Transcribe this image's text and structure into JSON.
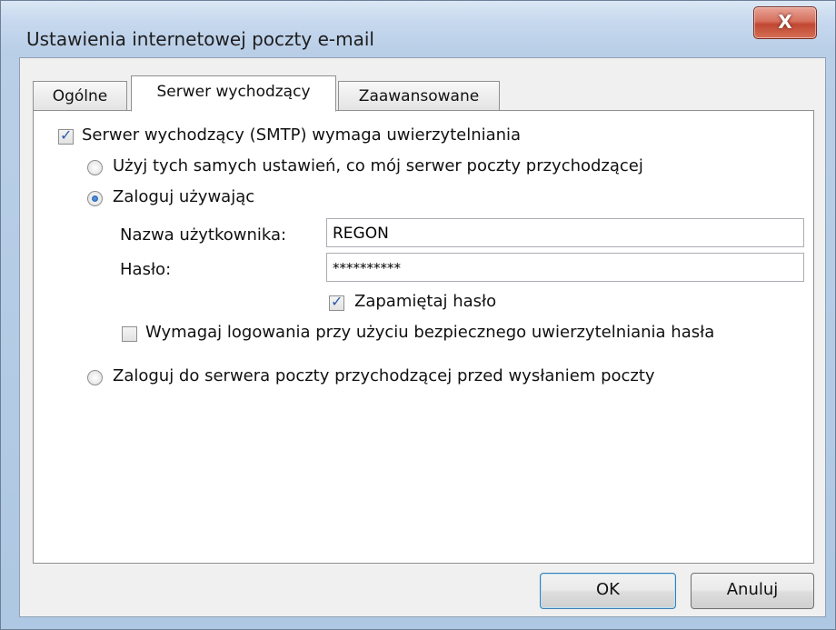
{
  "window": {
    "title": "Ustawienia internetowej poczty e-mail",
    "close_glyph": "X"
  },
  "tabs": [
    {
      "label": "Ogólne",
      "active": false
    },
    {
      "label": "Serwer wychodzący",
      "active": true
    },
    {
      "label": "Zaawansowane",
      "active": false
    }
  ],
  "panel": {
    "smtp_auth_checkbox": {
      "label": "Serwer wychodzący (SMTP) wymaga uwierzytelniania",
      "checked": true
    },
    "radio_same_settings": {
      "label": "Użyj tych samych ustawień, co mój serwer poczty przychodzącej",
      "checked": false
    },
    "radio_login_using": {
      "label": "Zaloguj używając",
      "checked": true
    },
    "username": {
      "label": "Nazwa użytkownika:",
      "value": "REGON"
    },
    "password": {
      "label": "Hasło:",
      "value": "**********"
    },
    "remember_password": {
      "label": "Zapamiętaj hasło",
      "checked": true
    },
    "require_spa": {
      "label": "Wymagaj logowania przy użyciu bezpiecznego uwierzytelniania hasła",
      "checked": false
    },
    "radio_login_incoming_first": {
      "label": "Zaloguj do serwera poczty przychodzącej przed wysłaniem poczty",
      "checked": false
    }
  },
  "buttons": {
    "ok": "OK",
    "cancel": "Anuluj"
  },
  "colors": {
    "accent_check": "#2a5aa8",
    "close_button": "#c14833"
  }
}
